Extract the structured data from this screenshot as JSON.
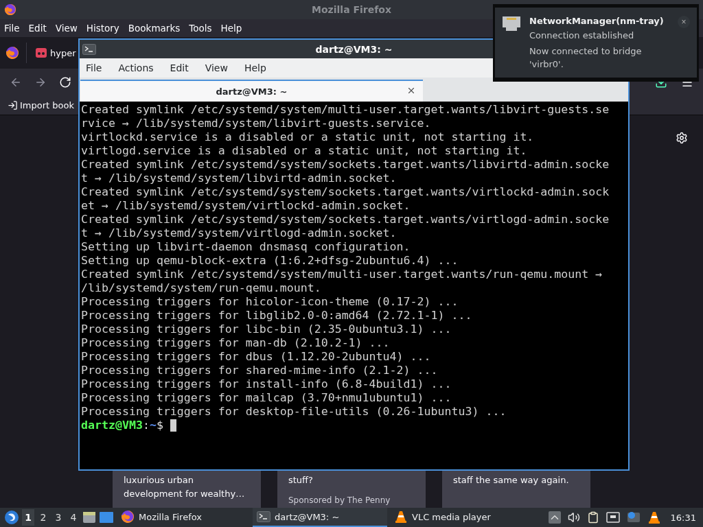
{
  "firefox": {
    "title": "Mozilla Firefox",
    "menu": [
      "File",
      "Edit",
      "View",
      "History",
      "Bookmarks",
      "Tools",
      "Help"
    ],
    "tabs": [
      {
        "label": "hyper",
        "selected": false
      }
    ],
    "bookmarks": [
      "Import book"
    ],
    "cards": [
      {
        "lines": [
          "luxurious urban",
          "development for wealthy…"
        ]
      },
      {
        "lines": [
          "stuff?"
        ],
        "sponsor": "Sponsored by The Penny"
      },
      {
        "lines": [
          "staff the same way again."
        ]
      }
    ]
  },
  "terminal": {
    "title": "dartz@VM3: ~",
    "menu": [
      "File",
      "Actions",
      "Edit",
      "View",
      "Help"
    ],
    "tabs": [
      {
        "label": "dartz@VM3: ~",
        "selected": true
      }
    ],
    "lines": [
      "Created symlink /etc/systemd/system/multi-user.target.wants/libvirt-guests.se",
      "rvice → /lib/systemd/system/libvirt-guests.service.",
      "virtlockd.service is a disabled or a static unit, not starting it.",
      "virtlogd.service is a disabled or a static unit, not starting it.",
      "Created symlink /etc/systemd/system/sockets.target.wants/libvirtd-admin.socke",
      "t → /lib/systemd/system/libvirtd-admin.socket.",
      "Created symlink /etc/systemd/system/sockets.target.wants/virtlockd-admin.sock",
      "et → /lib/systemd/system/virtlockd-admin.socket.",
      "Created symlink /etc/systemd/system/sockets.target.wants/virtlogd-admin.socke",
      "t → /lib/systemd/system/virtlogd-admin.socket.",
      "Setting up libvirt-daemon dnsmasq configuration.",
      "Setting up qemu-block-extra (1:6.2+dfsg-2ubuntu6.4) ...",
      "Created symlink /etc/systemd/system/multi-user.target.wants/run-qemu.mount →",
      "/lib/systemd/system/run-qemu.mount.",
      "Processing triggers for hicolor-icon-theme (0.17-2) ...",
      "Processing triggers for libglib2.0-0:amd64 (2.72.1-1) ...",
      "Processing triggers for libc-bin (2.35-0ubuntu3.1) ...",
      "Processing triggers for man-db (2.10.2-1) ...",
      "Processing triggers for dbus (1.12.20-2ubuntu4) ...",
      "Processing triggers for shared-mime-info (2.1-2) ...",
      "Processing triggers for install-info (6.8-4build1) ...",
      "Processing triggers for mailcap (3.70+nmu1ubuntu1) ...",
      "Processing triggers for desktop-file-utils (0.26-1ubuntu3) ..."
    ],
    "prompt": {
      "user_host": "dartz@VM3",
      "separator": ":",
      "path": "~",
      "symbol": "$"
    }
  },
  "notification": {
    "app": "NetworkManager(nm-tray)",
    "summary": "Connection established",
    "body": "Now connected to bridge 'virbr0'.",
    "close": "×"
  },
  "taskbar": {
    "workspaces": [
      {
        "label": "1",
        "selected": true
      },
      {
        "label": "2",
        "selected": false
      },
      {
        "label": "3",
        "selected": false
      },
      {
        "label": "4",
        "selected": false
      }
    ],
    "tasks": [
      {
        "kind": "firefox",
        "label": "Mozilla Firefox",
        "selected": false
      },
      {
        "kind": "terminal",
        "label": "dartz@VM3: ~",
        "selected": true
      },
      {
        "kind": "vlc",
        "label": "VLC media player",
        "selected": false
      }
    ],
    "clock": "16:31"
  }
}
